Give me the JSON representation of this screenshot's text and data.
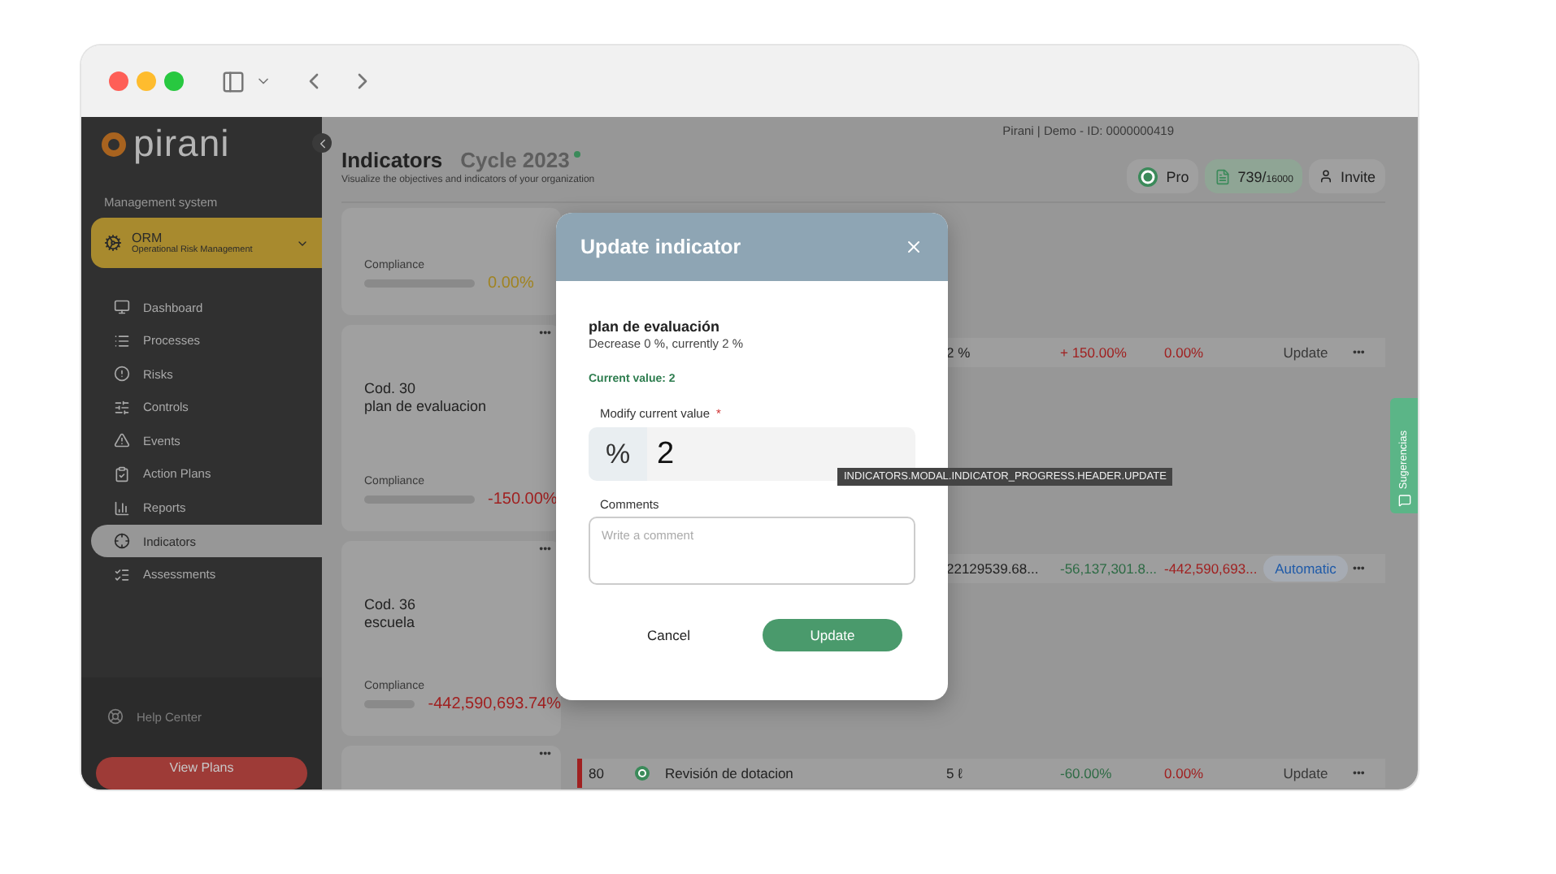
{
  "sidebar": {
    "logo": "pirani",
    "section_label": "Management system",
    "module": {
      "title": "ORM",
      "subtitle": "Operational Risk Management"
    },
    "items": [
      {
        "label": "Dashboard",
        "kind": "dashboard",
        "selected": false
      },
      {
        "label": "Processes",
        "kind": "processes",
        "selected": false
      },
      {
        "label": "Risks",
        "kind": "risks",
        "selected": false
      },
      {
        "label": "Controls",
        "kind": "controls",
        "selected": false
      },
      {
        "label": "Events",
        "kind": "events",
        "selected": false
      },
      {
        "label": "Action Plans",
        "kind": "plans",
        "selected": false
      },
      {
        "label": "Reports",
        "kind": "reports",
        "selected": false
      },
      {
        "label": "Indicators",
        "kind": "indicators",
        "selected": true
      },
      {
        "label": "Assessments",
        "kind": "assessments",
        "selected": false
      }
    ],
    "help": "Help Center",
    "plans_button": "View Plans"
  },
  "header": {
    "account": "Pirani | Demo - ID: 0000000419",
    "title": "Indicators",
    "cycle": "Cycle 2023",
    "subtitle": "Visualize the objectives and indicators of your organization",
    "plan": "Pro",
    "usage": "739/",
    "usage_total": "16000",
    "invite": "Invite"
  },
  "indicators": [
    {
      "compliance_label": "Compliance",
      "compliance": "0.00%",
      "color": "#a08320"
    },
    {
      "code": "Cod. 30",
      "name": "plan de evaluacion",
      "compliance_label": "Compliance",
      "compliance": "-150.00%",
      "color": "#a02020",
      "more": "•••",
      "row": {
        "value": "2 %",
        "variance": "+ 150.00%",
        "color": "#a02020",
        "compliance": "0.00%",
        "action": "Update",
        "kind": "text",
        "more": "•••"
      }
    },
    {
      "code": "Cod. 36",
      "name": "escuela",
      "compliance_label": "Compliance",
      "compliance": "-442,590,693.74%",
      "color": "#a02020",
      "more": "•••",
      "row": {
        "value": "22129539.68...",
        "variance": "-56,137,301.8...",
        "color": "#2e6b45",
        "compliance": "-442,590,693...",
        "action": "Automatic",
        "kind": "pill",
        "more": "•••"
      }
    },
    {
      "more": "•••",
      "row": {
        "number": "80",
        "name": "Revisión de dotacion",
        "value": "5 ℓ",
        "variance": "-60.00%",
        "color": "#2e6b45",
        "compliance": "0.00%",
        "action": "Update",
        "kind": "text",
        "more": "•••"
      }
    }
  ],
  "modal": {
    "title": "Update indicator",
    "indicator_name": "plan de evaluación",
    "description": "Decrease 0 %, currently 2 %",
    "current_value": "Current value: 2",
    "field_label": "Modify current value",
    "required_mark": "*",
    "unit": "%",
    "value": "2",
    "comments_label": "Comments",
    "comments_placeholder": "Write a comment",
    "cancel": "Cancel",
    "submit": "Update"
  },
  "tooltip": "INDICATORS.MODAL.INDICATOR_PROGRESS.HEADER.UPDATE",
  "feedback_tab": "Sugerencias"
}
